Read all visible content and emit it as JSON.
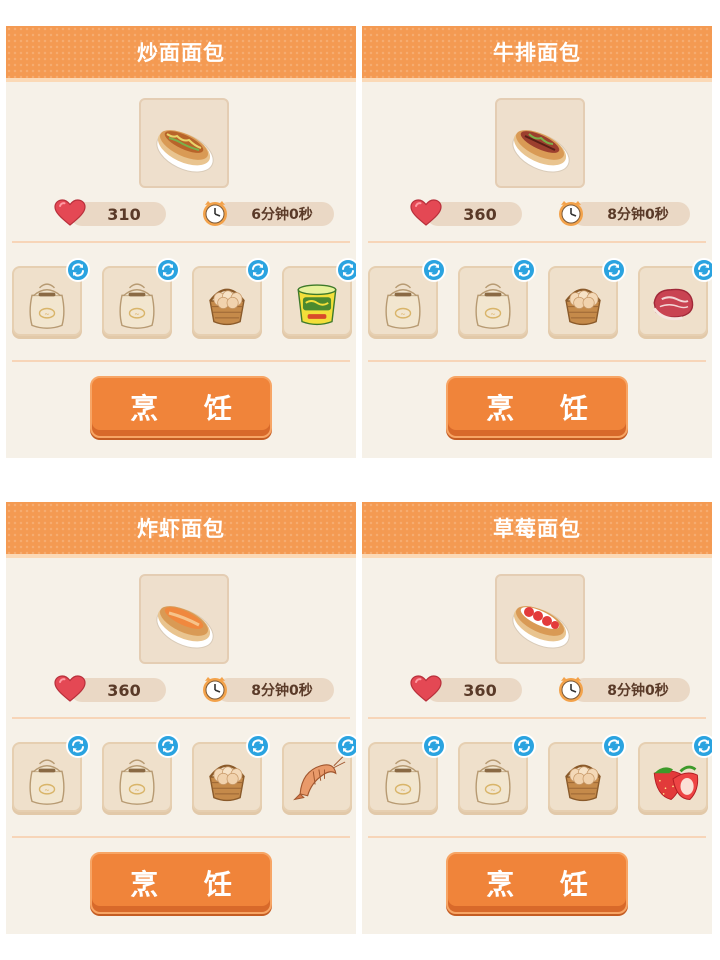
{
  "cook_label": "烹 饪",
  "cards": [
    {
      "title": "炒面面包",
      "dish": "yakisoba-hotdog-bun",
      "love": "310",
      "time": "6分钟0秒",
      "ingredients": [
        "flour-sack",
        "flour-sack",
        "egg-basket",
        "instant-noodle-cup"
      ]
    },
    {
      "title": "牛排面包",
      "dish": "steak-hotdog-bun",
      "love": "360",
      "time": "8分钟0秒",
      "ingredients": [
        "flour-sack",
        "flour-sack",
        "egg-basket",
        "raw-steak"
      ]
    },
    {
      "title": "炸虾面包",
      "dish": "fried-shrimp-bun",
      "love": "360",
      "time": "8分钟0秒",
      "ingredients": [
        "flour-sack",
        "flour-sack",
        "egg-basket",
        "shrimp"
      ]
    },
    {
      "title": "草莓面包",
      "dish": "strawberry-bun",
      "love": "360",
      "time": "8分钟0秒",
      "ingredients": [
        "flour-sack",
        "flour-sack",
        "egg-basket",
        "strawberry"
      ]
    }
  ],
  "colors": {
    "header": "#f49a52",
    "card_bg": "#f6f1e8",
    "button": "#f0843a",
    "swap_badge": "#2aa3e0"
  }
}
